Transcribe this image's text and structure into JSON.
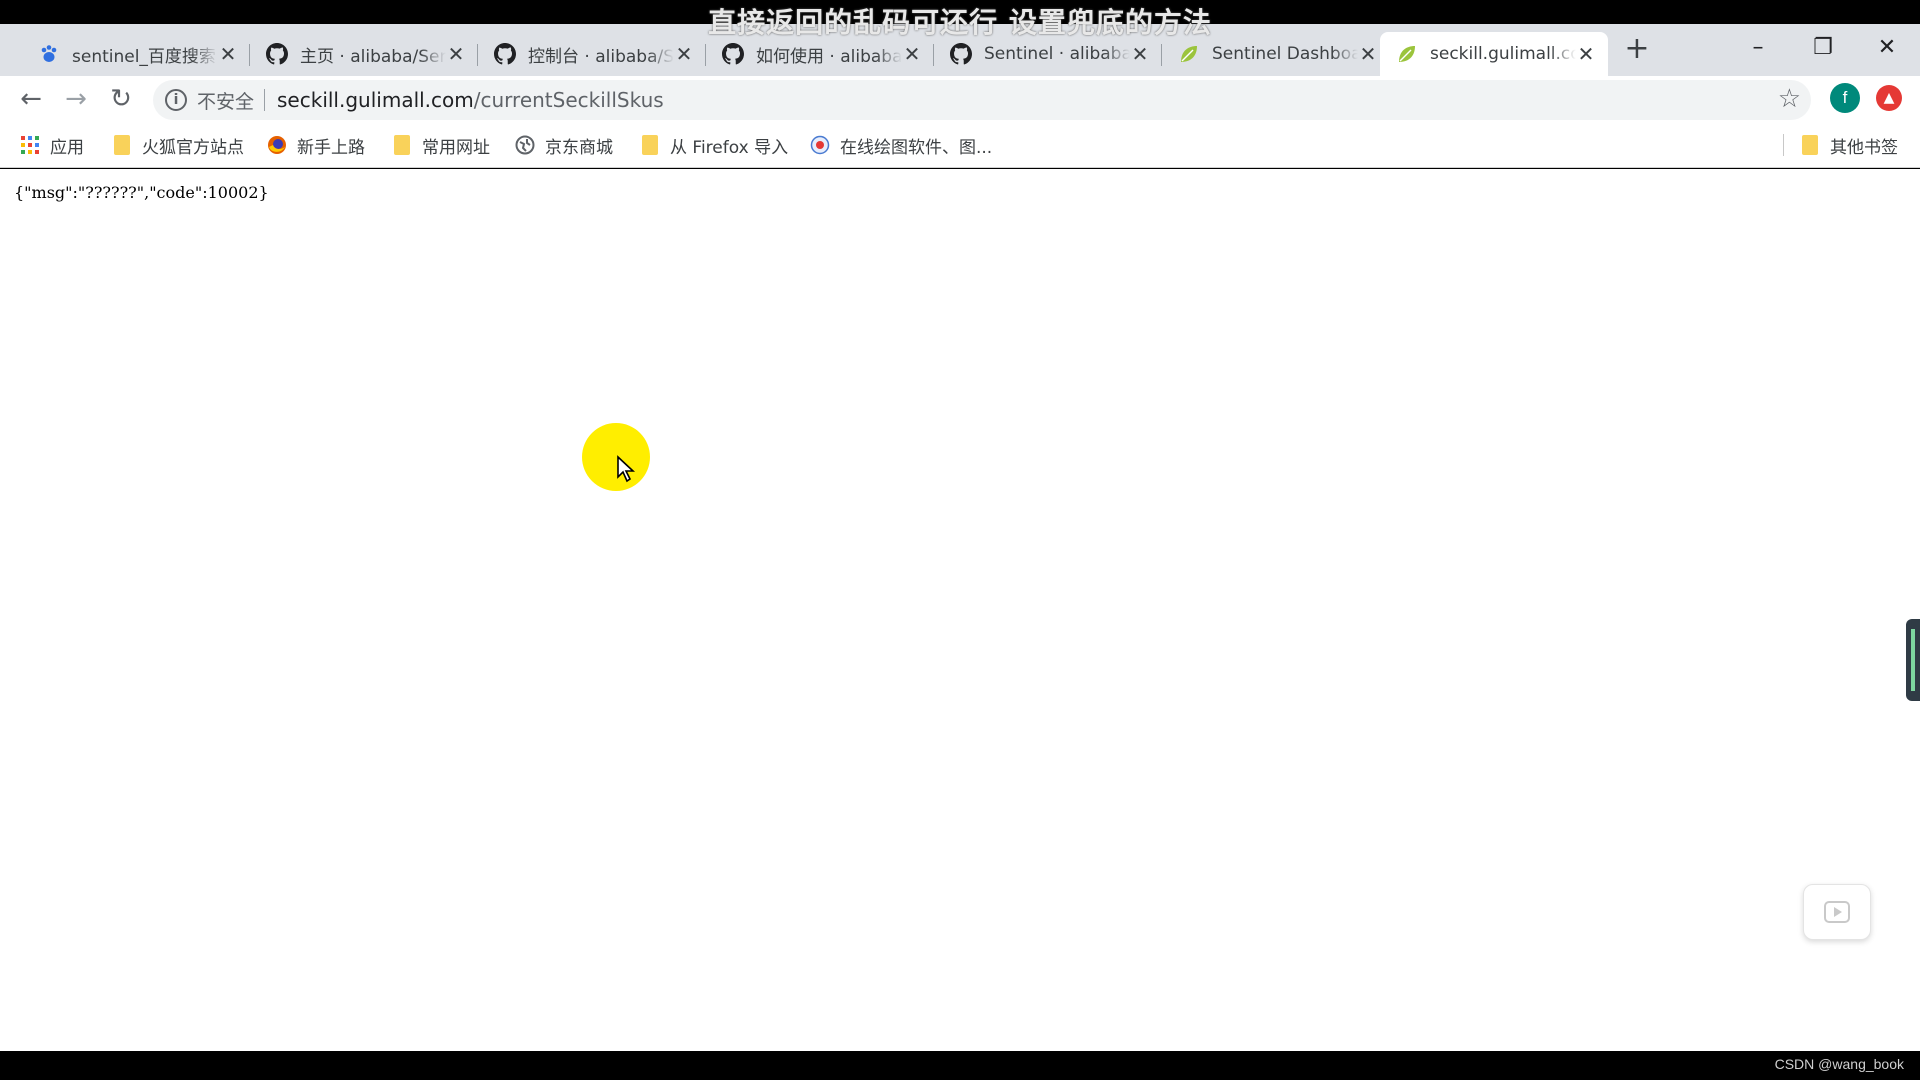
{
  "video": {
    "subtitle": "直接返回的乱码可还行    设置兜底的方法",
    "watermark": "CSDN @wang_book"
  },
  "tabs": [
    {
      "title": "sentinel_百度搜索",
      "icon": "baidu-paw-icon",
      "active": false
    },
    {
      "title": "主页 · alibaba/Sentinel",
      "icon": "github-icon",
      "active": false
    },
    {
      "title": "控制台 · alibaba/Sentinel",
      "icon": "github-icon",
      "active": false
    },
    {
      "title": "如何使用 · alibaba/Sentinel",
      "icon": "github-icon",
      "active": false
    },
    {
      "title": "Sentinel · alibaba/Sentinel",
      "icon": "github-icon",
      "active": false
    },
    {
      "title": "Sentinel Dashboard",
      "icon": "spring-leaf-icon",
      "active": false
    },
    {
      "title": "seckill.gulimall.com",
      "icon": "spring-leaf-icon",
      "active": true
    }
  ],
  "toolbar": {
    "security_label": "不安全",
    "url_host": "seckill.gulimall.com",
    "url_path": "/currentSeckillSkus",
    "profile_initial": "f"
  },
  "bookmarks": {
    "apps": "应用",
    "items": [
      "火狐官方站点",
      "新手上路",
      "常用网址",
      "京东商城",
      "从 Firefox 导入",
      "在线绘图软件、图..."
    ],
    "other": "其他书签"
  },
  "page": {
    "body_text": "{\"msg\":\"??????\",\"code\":10002}"
  },
  "colors": {
    "tabstrip": "#dee1e6",
    "highlight": "#ffee00",
    "profile": "#00897b"
  }
}
